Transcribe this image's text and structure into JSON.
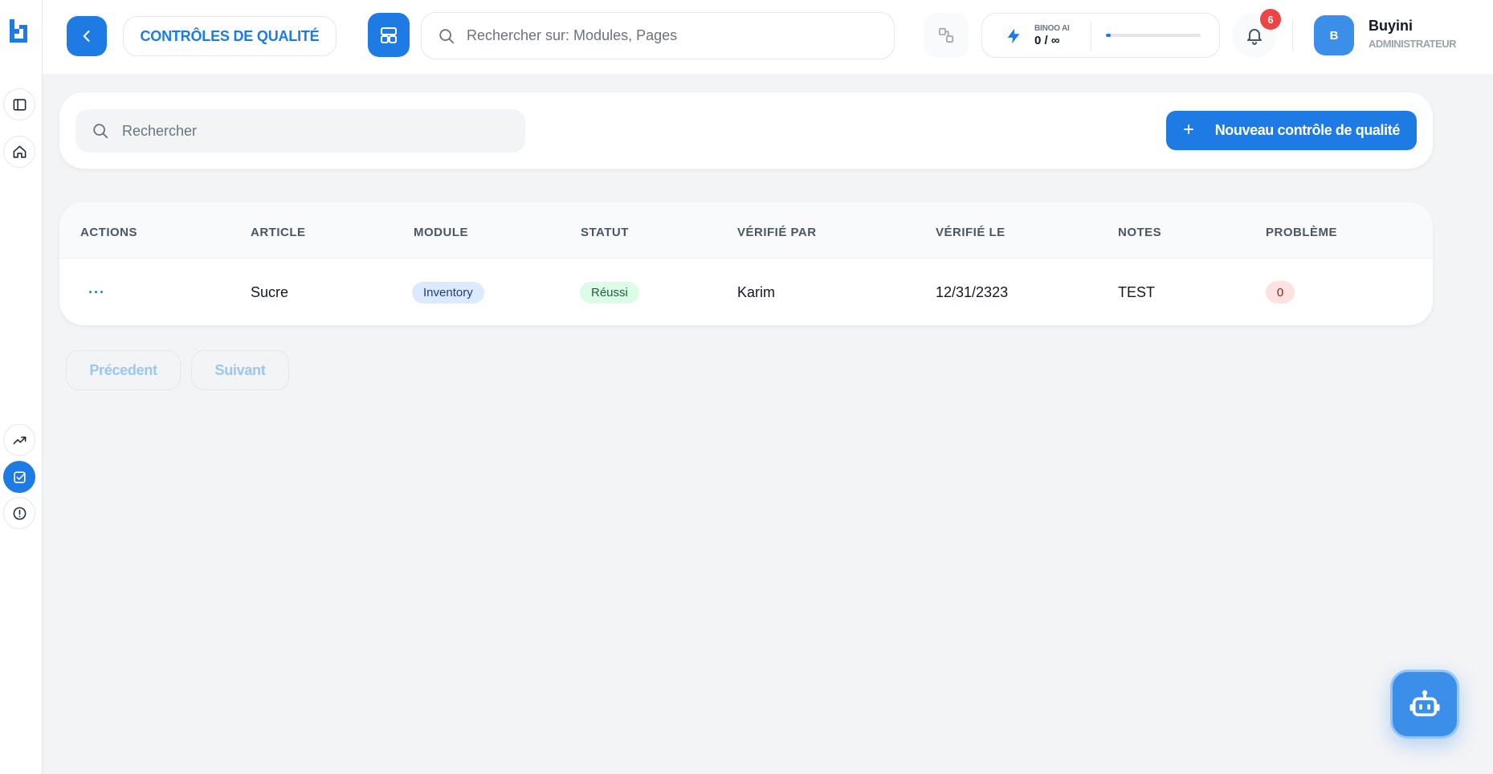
{
  "header": {
    "page_title": "CONTRÔLES DE QUALITÉ",
    "global_search_placeholder": "Rechercher sur: Modules, Pages",
    "ai_label": "BINOO AI",
    "ai_value": "0 / ∞",
    "ai_progress_percent": 5,
    "notification_count": "6",
    "user_initial": "B",
    "user_name": "Buyini",
    "user_role": "ADMINISTRATEUR"
  },
  "sidebar": {
    "items": [
      {
        "icon": "sidebar-panel-icon",
        "active": false
      },
      {
        "icon": "home-icon",
        "active": false
      },
      {
        "icon": "trending-up-icon",
        "active": false
      },
      {
        "icon": "check-square-icon",
        "active": true
      },
      {
        "icon": "alert-circle-icon",
        "active": false
      }
    ]
  },
  "toolbar": {
    "search_placeholder": "Rechercher",
    "new_button_label": "Nouveau contrôle de qualité"
  },
  "table": {
    "columns": [
      "ACTIONS",
      "ARTICLE",
      "MODULE",
      "STATUT",
      "VÉRIFIÉ PAR",
      "VÉRIFIÉ LE",
      "NOTES",
      "PROBLÈME"
    ],
    "rows": [
      {
        "actions": "···",
        "article": "Sucre",
        "module": "Inventory",
        "status": "Réussi",
        "verified_by": "Karim",
        "verified_on": "12/31/2323",
        "notes": "TEST",
        "problem": "0"
      }
    ]
  },
  "pagination": {
    "prev_label": "Précedent",
    "next_label": "Suivant"
  },
  "colors": {
    "primary": "#1e7be3",
    "badge_red": "#ef4444",
    "background": "#f3f4f6"
  }
}
